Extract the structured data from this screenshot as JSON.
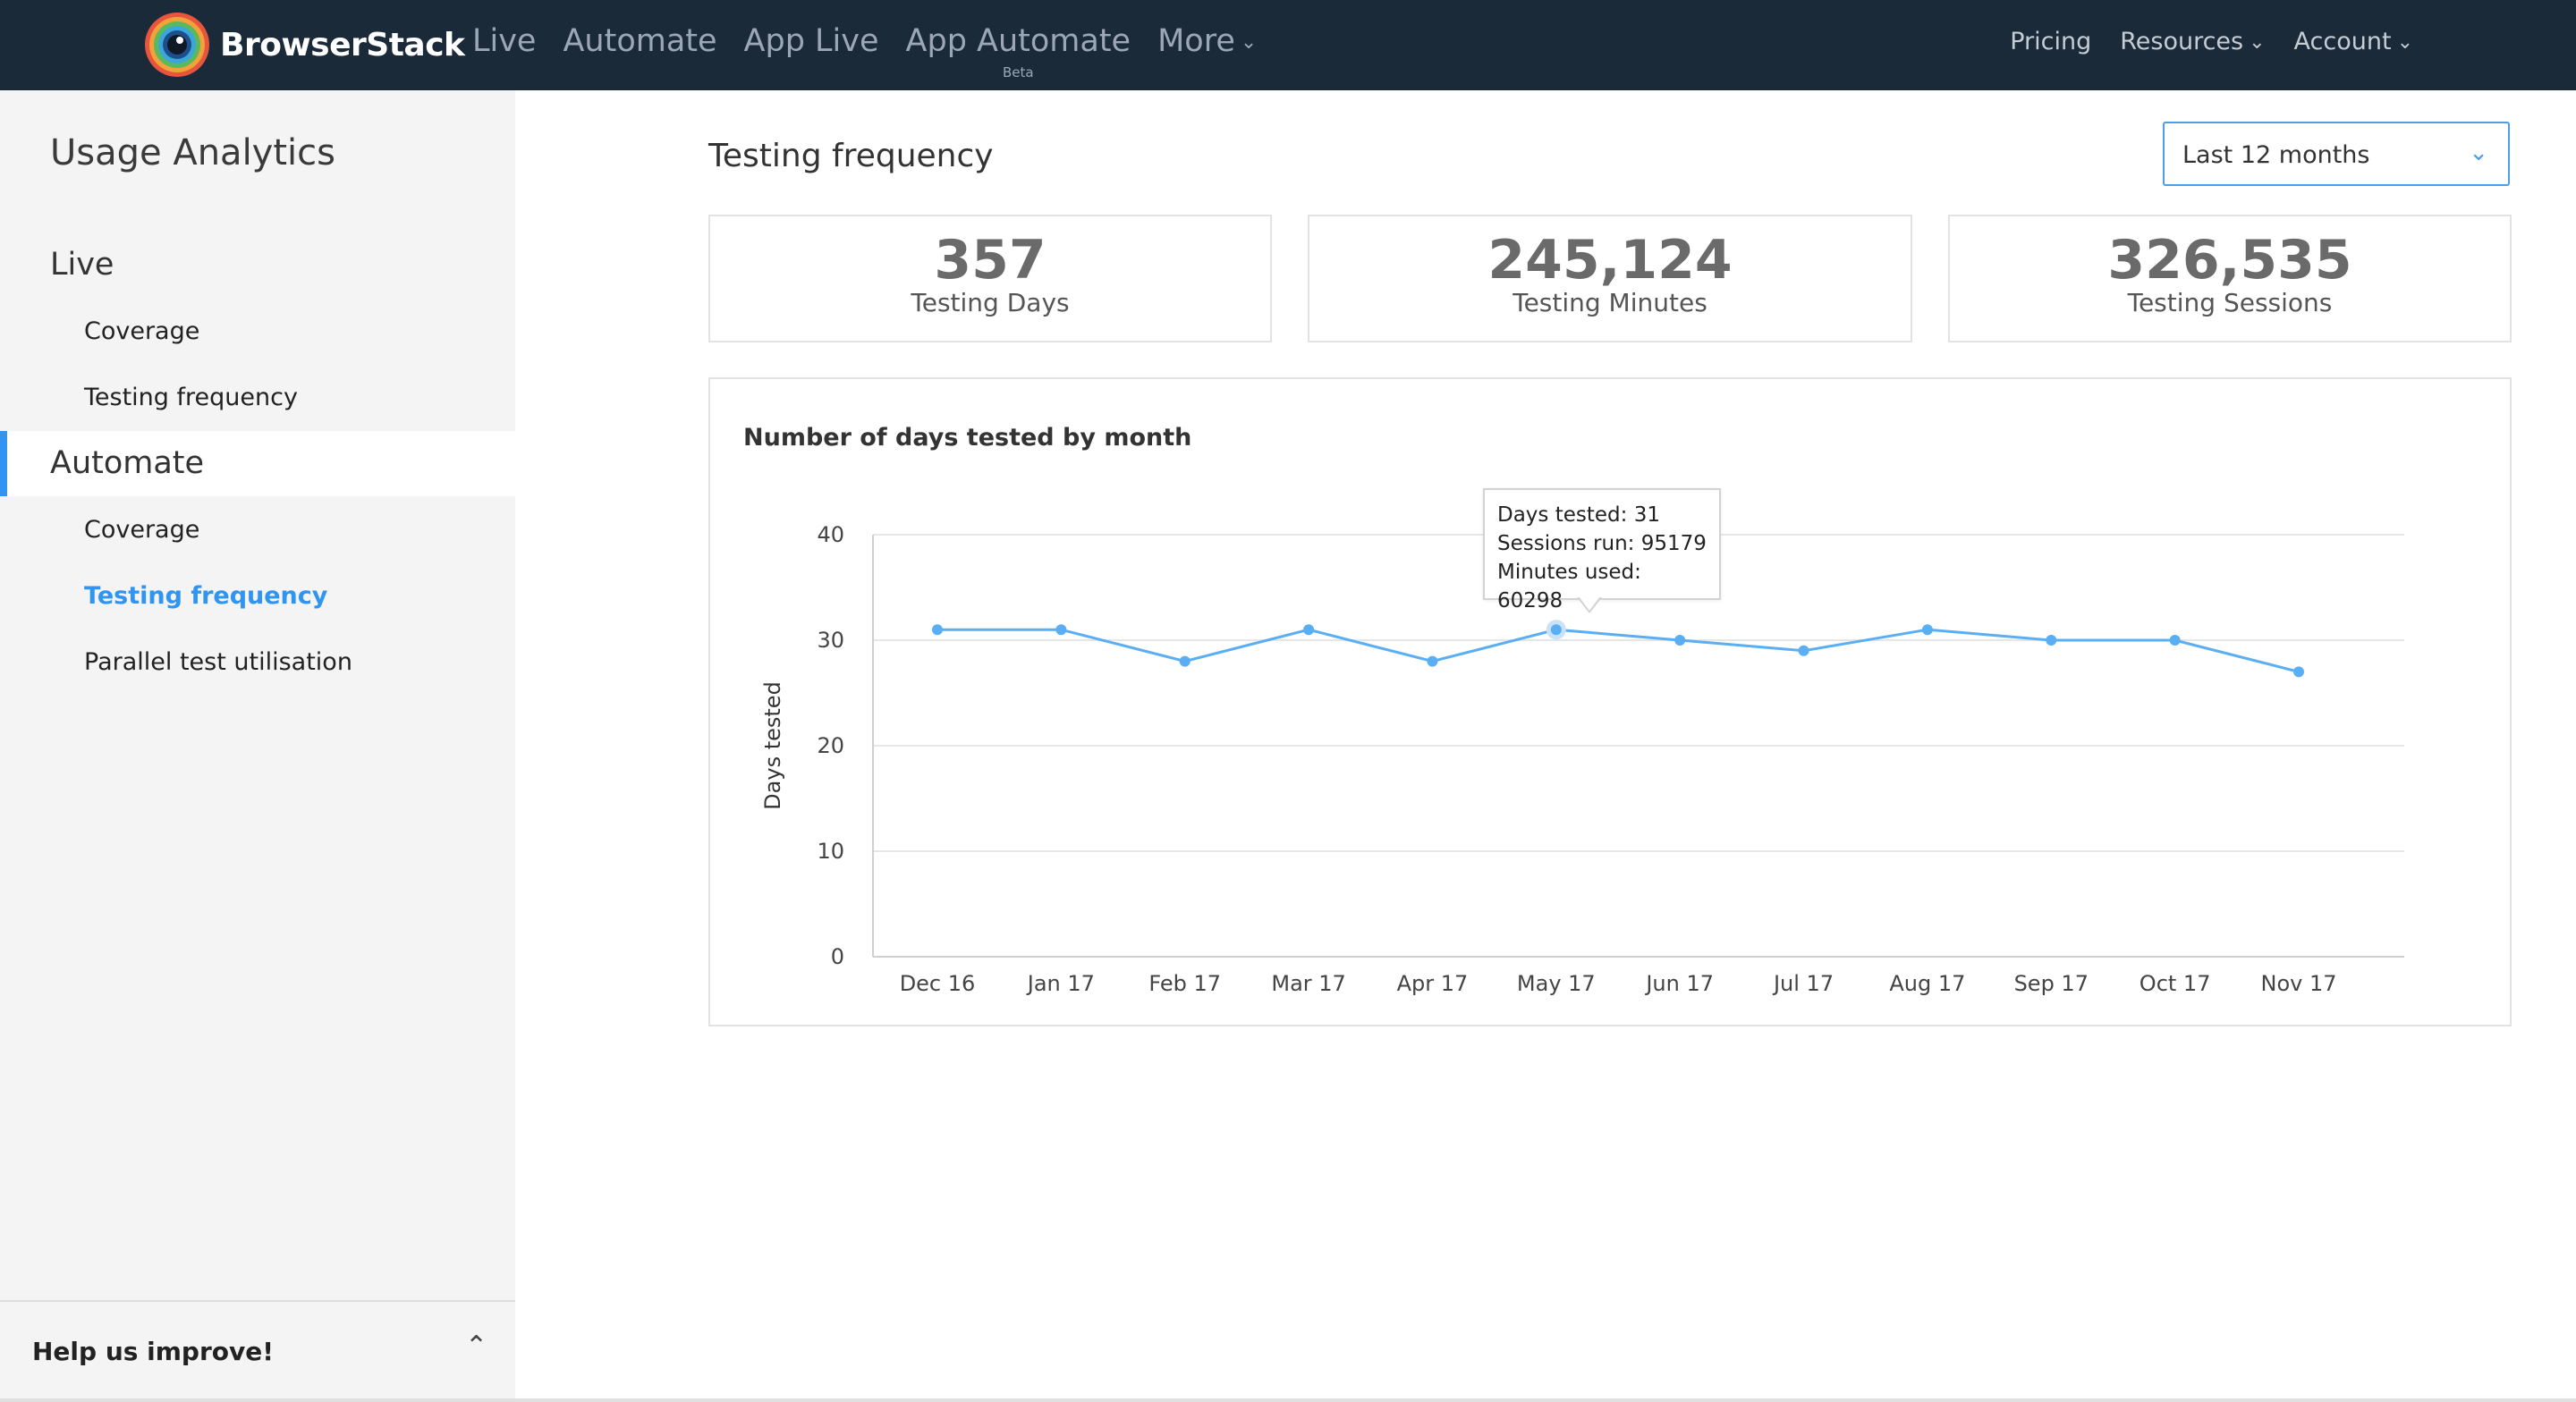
{
  "header": {
    "brand": "BrowserStack",
    "nav": [
      "Live",
      "Automate",
      "App Live",
      "App Automate",
      "More"
    ],
    "beta_badge": "Beta",
    "right_nav": [
      "Pricing",
      "Resources",
      "Account"
    ]
  },
  "sidebar": {
    "title": "Usage Analytics",
    "sections": [
      {
        "label": "Live",
        "items": [
          "Coverage",
          "Testing frequency"
        ]
      },
      {
        "label": "Automate",
        "items": [
          "Coverage",
          "Testing frequency",
          "Parallel test utilisation"
        ]
      }
    ],
    "active_item": "Automate / Testing frequency",
    "help": "Help us improve!"
  },
  "main": {
    "title": "Testing frequency",
    "range": "Last 12 months",
    "stats": [
      {
        "value": "357",
        "label": "Testing Days"
      },
      {
        "value": "245,124",
        "label": "Testing Minutes"
      },
      {
        "value": "326,535",
        "label": "Testing Sessions"
      }
    ]
  },
  "chart_data": {
    "type": "line",
    "title": "Number of days tested by month",
    "xlabel": "",
    "ylabel": "Days tested",
    "categories": [
      "Dec 16",
      "Jan 17",
      "Feb 17",
      "Mar 17",
      "Apr 17",
      "May 17",
      "Jun 17",
      "Jul 17",
      "Aug 17",
      "Sep 17",
      "Oct 17",
      "Nov 17"
    ],
    "values": [
      31,
      31,
      28,
      31,
      28,
      31,
      30,
      29,
      31,
      30,
      30,
      27
    ],
    "yticks": [
      0,
      10,
      20,
      30,
      40
    ],
    "ylim": [
      0,
      40
    ],
    "grid": true,
    "color": "#5aaef3"
  },
  "tooltip": {
    "days": "Days tested: 31",
    "sessions": "Sessions run: 95179",
    "minutes": "Minutes used: 60298"
  },
  "colors": {
    "header_bg": "#1b2a39",
    "accent": "#2f95f1",
    "sidebar_bg": "#f4f4f4"
  }
}
